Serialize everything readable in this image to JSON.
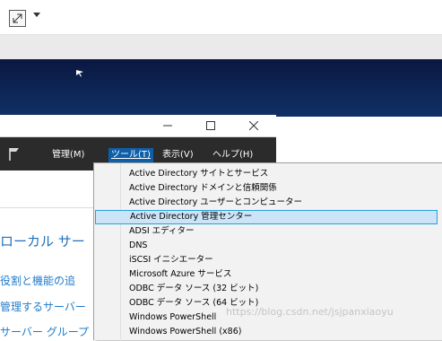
{
  "window": {
    "minimize_glyph": "—",
    "maximize_glyph": "☐",
    "close_glyph": "✕"
  },
  "menubar": {
    "manage": "管理(M)",
    "tools": "ツール(T)",
    "view": "表示(V)",
    "help": "ヘルプ(H)"
  },
  "content": {
    "heading": "ローカル サー",
    "links": [
      "役割と機能の追",
      "管理するサーバー",
      "サーバー グループ"
    ]
  },
  "tools_menu": {
    "items": [
      "Active Directory サイトとサービス",
      "Active Directory ドメインと信頼関係",
      "Active Directory ユーザーとコンピューター",
      "Active Directory 管理センター",
      "ADSI エディター",
      "DNS",
      "iSCSI イニシエーター",
      "Microsoft Azure サービス",
      "ODBC データ ソース (32 ビット)",
      "ODBC データ ソース (64 ビット)",
      "Windows PowerShell",
      "Windows PowerShell (x86)"
    ],
    "selected_index": 3
  },
  "watermark": "https://blog.csdn.net/jsjpanxiaoyu",
  "colors": {
    "desktop": "#0d2656",
    "menubar": "#2b2b2b",
    "accent": "#0f5fa8",
    "link": "#1f7bc9",
    "highlight": "#cce4f7",
    "highlight_border": "#26a0da"
  },
  "icons": [
    "expand-icon",
    "chevron-down-icon",
    "mouse-cursor-icon",
    "flag-icon"
  ]
}
